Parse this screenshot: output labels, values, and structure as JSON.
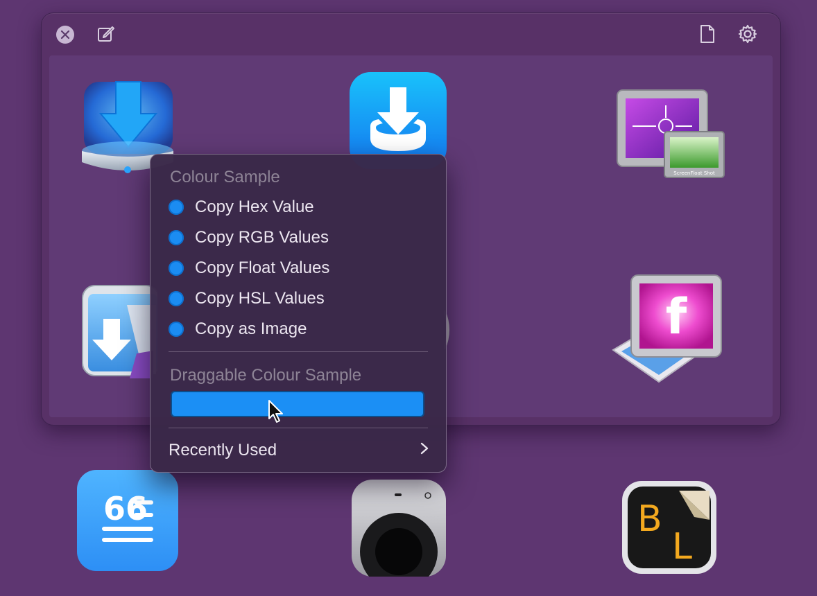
{
  "window": {
    "toolbar": {
      "close_icon": "close-circle-icon",
      "edit_icon": "compose-icon",
      "document_icon": "document-icon",
      "settings_icon": "gear-icon"
    },
    "apps": [
      {
        "name": "downie-icon"
      },
      {
        "name": "app-store-download-icon"
      },
      {
        "name": "screenfloat-icon"
      },
      {
        "name": "download-app-icon"
      },
      {
        "name": "flashcard-hero-icon"
      },
      {
        "name": "quotes-app-icon"
      },
      {
        "name": "apple-tv-remote-icon"
      },
      {
        "name": "bl-app-icon"
      }
    ],
    "screenfloat_label": "ScreenFloat Shot"
  },
  "context_menu": {
    "section1_header": "Colour Sample",
    "items": [
      {
        "label": "Copy Hex Value"
      },
      {
        "label": "Copy RGB Values"
      },
      {
        "label": "Copy Float Values"
      },
      {
        "label": "Copy HSL Values"
      },
      {
        "label": "Copy as Image"
      }
    ],
    "section2_header": "Draggable Colour Sample",
    "swatch_color": "#1B8FF5",
    "recently_used": "Recently Used"
  },
  "colors": {
    "background": "#5E3671",
    "accent": "#1B8CF2"
  }
}
